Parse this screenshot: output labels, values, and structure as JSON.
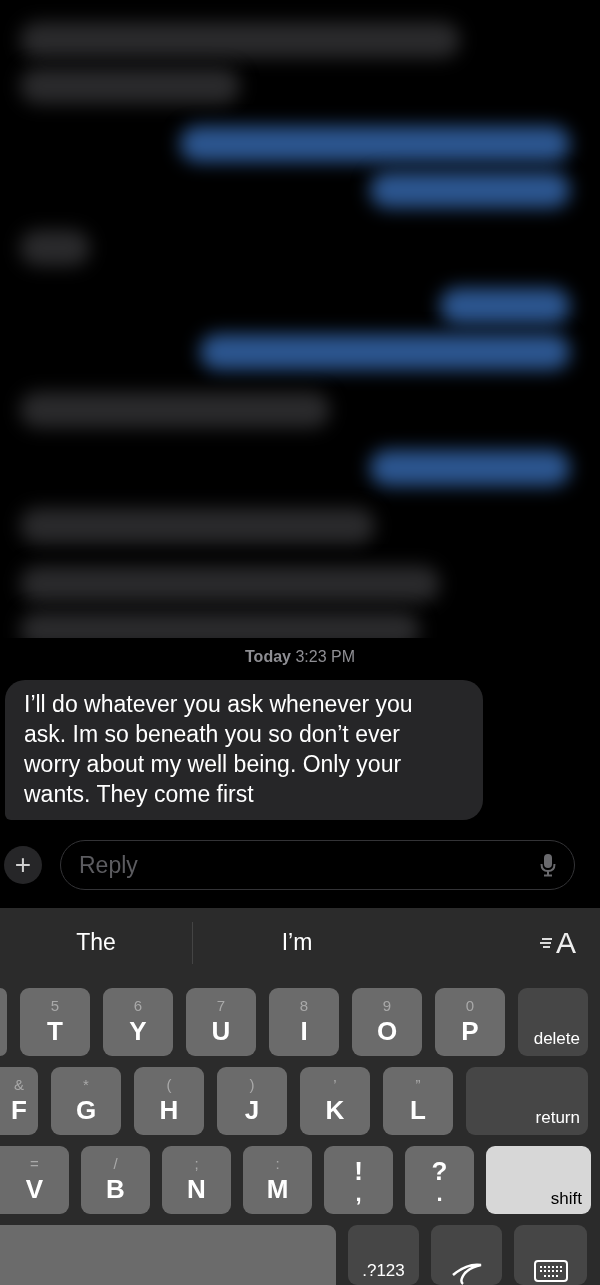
{
  "blurred_messages": [
    {
      "kind": "incoming"
    },
    {
      "kind": "outgoing"
    },
    {
      "kind": "incoming"
    },
    {
      "kind": "outgoing"
    },
    {
      "kind": "incoming"
    },
    {
      "kind": "outgoing"
    },
    {
      "kind": "incoming"
    },
    {
      "kind": "incoming"
    }
  ],
  "timestamp": "**Today** 3:23 PM",
  "message": {
    "kind": "incoming",
    "text": "I’ll do whatever you ask whenever you ask. Im so beneath you so don’t ever worry about my well being. Only your wants. They come first"
  },
  "compose": {
    "add_button": "+",
    "placeholder": "Reply"
  },
  "suggestions": [
    {
      "text": "The"
    },
    {
      "text": "I’m"
    }
  ],
  "text_format_button": {
    "label": "A"
  },
  "keyboard_rows": [
    [
      {
        "kind": "cut"
      },
      {
        "kind": "letter",
        "label": "T",
        "alt": "5"
      },
      {
        "kind": "letter",
        "label": "Y",
        "alt": "6"
      },
      {
        "kind": "letter",
        "label": "U",
        "alt": "7"
      },
      {
        "kind": "letter",
        "label": "I",
        "alt": "8"
      },
      {
        "kind": "letter",
        "label": "O",
        "alt": "9"
      },
      {
        "kind": "letter",
        "label": "P",
        "alt": "0"
      },
      {
        "kind": "function",
        "label": "delete"
      }
    ],
    [
      {
        "kind": "letter",
        "label": "F",
        "alt": "&"
      },
      {
        "kind": "letter",
        "label": "G",
        "alt": "*"
      },
      {
        "kind": "letter",
        "label": "H",
        "alt": "("
      },
      {
        "kind": "letter",
        "label": "J",
        "alt": ")"
      },
      {
        "kind": "letter",
        "label": "K",
        "alt": "’"
      },
      {
        "kind": "letter",
        "label": "L",
        "alt": "”"
      },
      {
        "kind": "function",
        "label": "return"
      }
    ],
    [
      {
        "kind": "letter",
        "label": "V",
        "alt": "="
      },
      {
        "kind": "letter",
        "label": "B",
        "alt": "/"
      },
      {
        "kind": "letter",
        "label": "N",
        "alt": ";"
      },
      {
        "kind": "letter",
        "label": "M",
        "alt": ":"
      },
      {
        "kind": "punct",
        "label": "!",
        "alt": ","
      },
      {
        "kind": "punct",
        "label": "?",
        "alt": "."
      },
      {
        "kind": "shift",
        "label": "shift",
        "on": true
      }
    ],
    [
      {
        "kind": "space"
      },
      {
        "kind": "function",
        "label": ".?123"
      },
      {
        "kind": "handwriting"
      },
      {
        "kind": "keyboard"
      }
    ]
  ]
}
